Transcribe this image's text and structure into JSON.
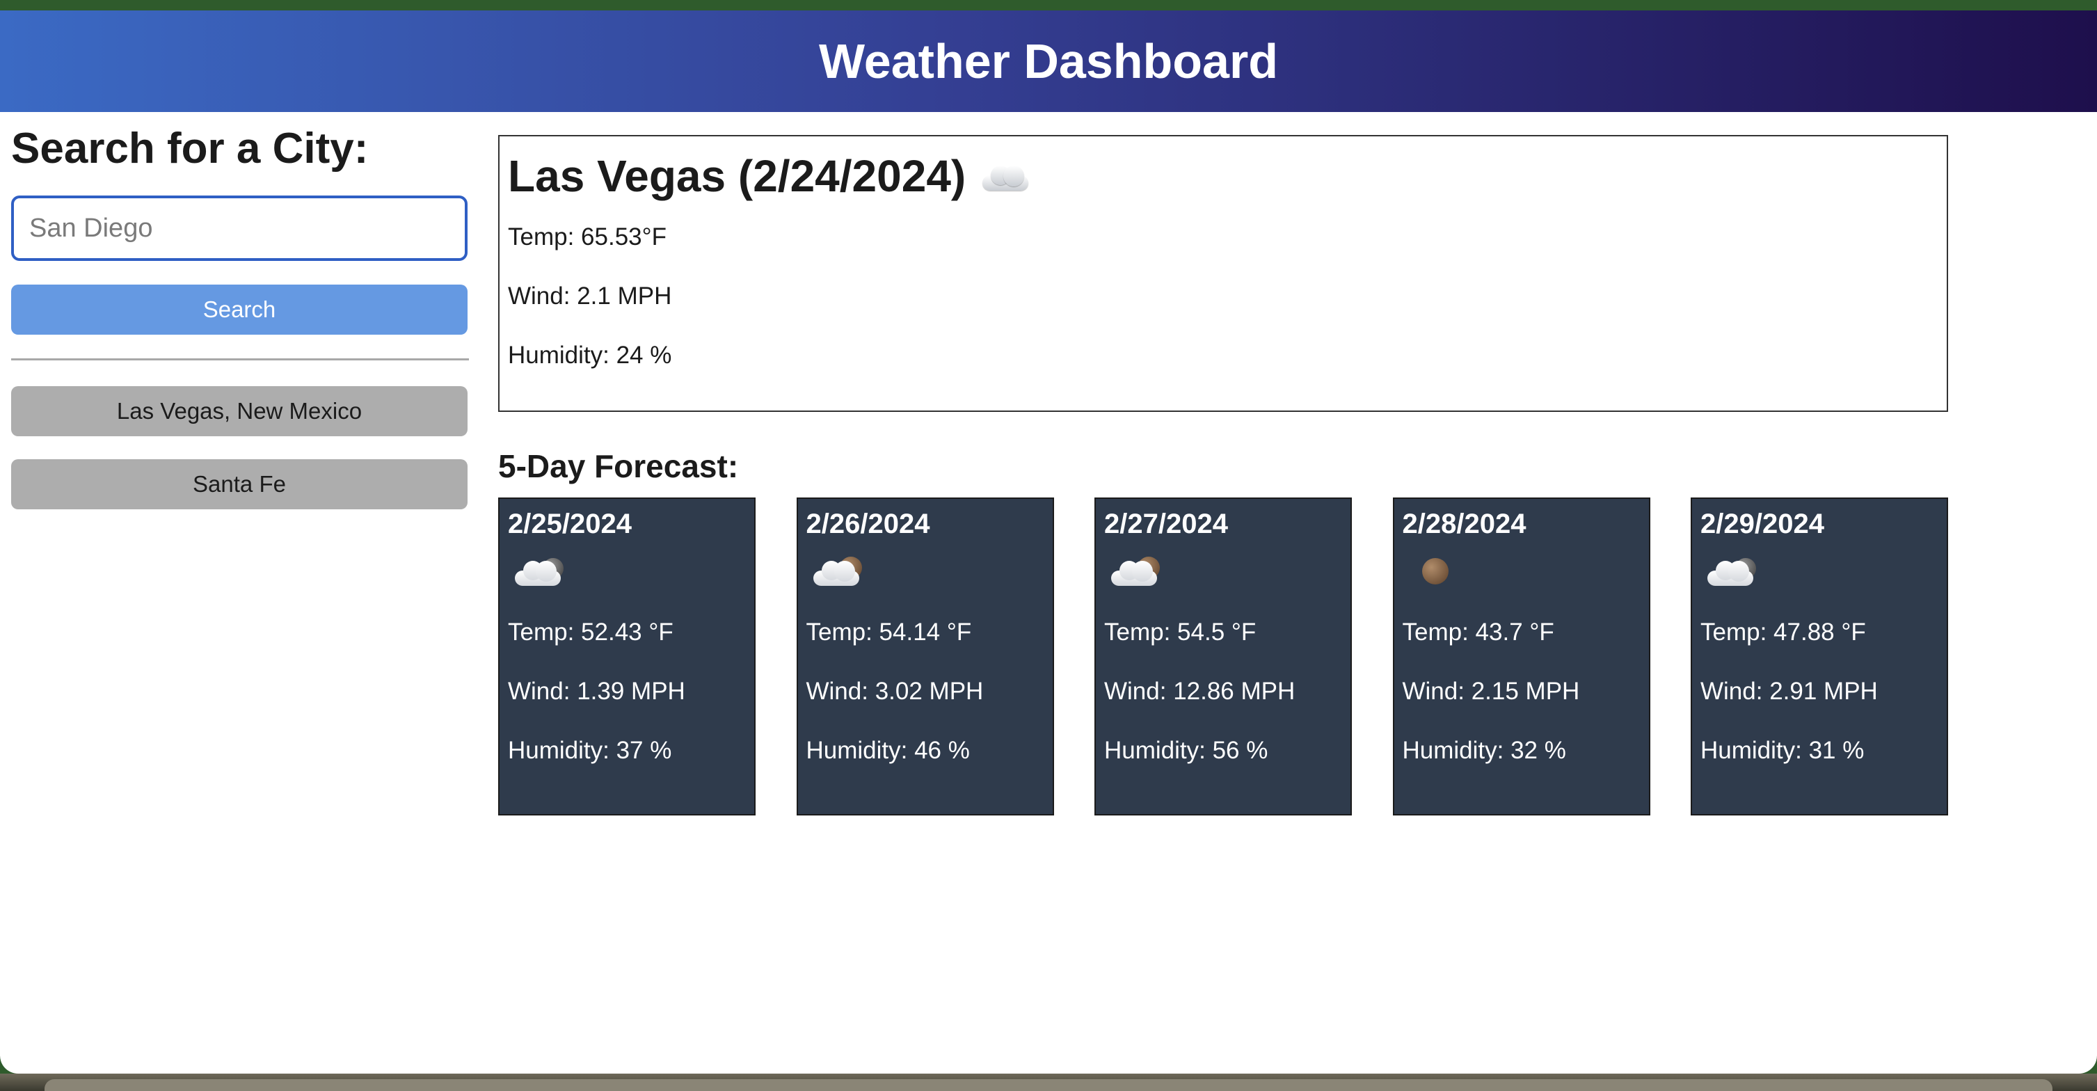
{
  "header": {
    "title": "Weather Dashboard"
  },
  "sidebar": {
    "heading": "Search for a City:",
    "search_placeholder": "San Diego",
    "search_button": "Search",
    "history": [
      "Las Vegas, New Mexico",
      "Santa Fe"
    ]
  },
  "current": {
    "title": "Las Vegas (2/24/2024)",
    "icon": "cloud-icon",
    "temp": "Temp: 65.53°F",
    "wind": "Wind: 2.1 MPH",
    "humidity": "Humidity: 24 %"
  },
  "forecast": {
    "title": "5-Day Forecast:",
    "days": [
      {
        "date": "2/25/2024",
        "icon": "cloud-moon-icon",
        "temp": "Temp: 52.43 °F",
        "wind": "Wind: 1.39 MPH",
        "humidity": "Humidity: 37 %"
      },
      {
        "date": "2/26/2024",
        "icon": "cloud-moon-icon",
        "temp": "Temp: 54.14 °F",
        "wind": "Wind: 3.02 MPH",
        "humidity": "Humidity: 46 %"
      },
      {
        "date": "2/27/2024",
        "icon": "cloud-moon-icon",
        "temp": "Temp: 54.5 °F",
        "wind": "Wind: 12.86 MPH",
        "humidity": "Humidity: 56 %"
      },
      {
        "date": "2/28/2024",
        "icon": "moon-icon",
        "temp": "Temp: 43.7 °F",
        "wind": "Wind: 2.15 MPH",
        "humidity": "Humidity: 32 %"
      },
      {
        "date": "2/29/2024",
        "icon": "cloud-moon-icon",
        "temp": "Temp: 47.88 °F",
        "wind": "Wind: 2.91 MPH",
        "humidity": "Humidity: 31 %"
      }
    ]
  }
}
